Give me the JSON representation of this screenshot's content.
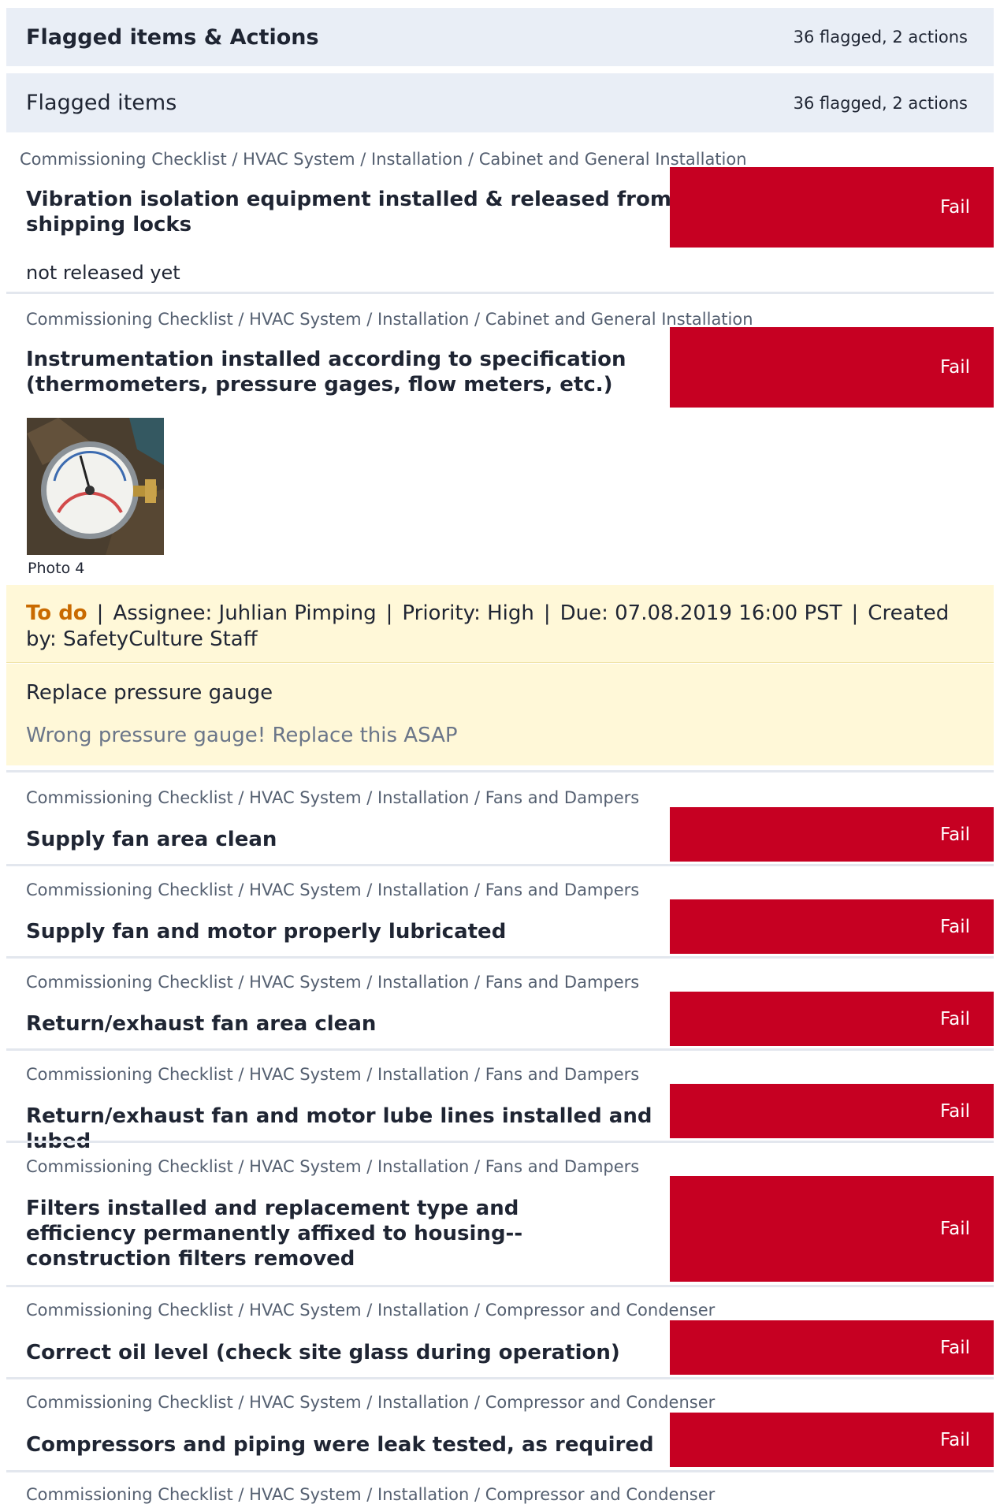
{
  "header": {
    "title": "Flagged items & Actions",
    "count": "36 flagged, 2 actions"
  },
  "section": {
    "title": "Flagged items",
    "count": "36 flagged, 2 actions"
  },
  "items": [
    {
      "breadcrumb": "Commissioning Checklist / HVAC System / Installation / Cabinet and General Installation",
      "question": "Vibration isolation equipment installed & released from shipping locks",
      "response": "Fail",
      "note": "not released yet"
    },
    {
      "breadcrumb": "Commissioning Checklist / HVAC System / Installation / Cabinet and General Installation",
      "question": "Instrumentation installed according to specification (thermometers, pressure gages, flow meters, etc.)",
      "response": "Fail",
      "photo_label": "Photo 4"
    },
    {
      "breadcrumb": "Commissioning Checklist / HVAC System / Installation / Fans and Dampers",
      "question": "Supply fan area clean",
      "response": "Fail"
    },
    {
      "breadcrumb": "Commissioning Checklist / HVAC System / Installation / Fans and Dampers",
      "question": "Supply fan and motor properly lubricated",
      "response": "Fail"
    },
    {
      "breadcrumb": "Commissioning Checklist / HVAC System / Installation / Fans and Dampers",
      "question": "Return/exhaust fan area clean",
      "response": "Fail"
    },
    {
      "breadcrumb": "Commissioning Checklist / HVAC System / Installation / Fans and Dampers",
      "question": "Return/exhaust fan and motor lube lines installed and lubed",
      "response": "Fail"
    },
    {
      "breadcrumb": "Commissioning Checklist / HVAC System / Installation / Fans and Dampers",
      "question": "Filters installed and replacement type and efficiency permanently affixed to housing--construction filters removed",
      "response": "Fail"
    },
    {
      "breadcrumb": "Commissioning Checklist / HVAC System / Installation / Compressor and Condenser",
      "question": "Correct oil level (check site glass during operation)",
      "response": "Fail"
    },
    {
      "breadcrumb": "Commissioning Checklist / HVAC System / Installation / Compressor and Condenser",
      "question": "Compressors and piping were leak tested, as required",
      "response": "Fail"
    },
    {
      "breadcrumb": "Commissioning Checklist / HVAC System / Installation / Compressor and Condenser"
    }
  ],
  "action": {
    "status": "To do",
    "assignee": "Assignee: Juhlian Pimping",
    "priority": "Priority: High",
    "due": "Due: 07.08.2019 16:00 PST",
    "created_by": "Created by: SafetyCulture Staff",
    "separator": "|",
    "title": "Replace pressure gauge",
    "description": "Wrong pressure gauge! Replace this ASAP"
  }
}
